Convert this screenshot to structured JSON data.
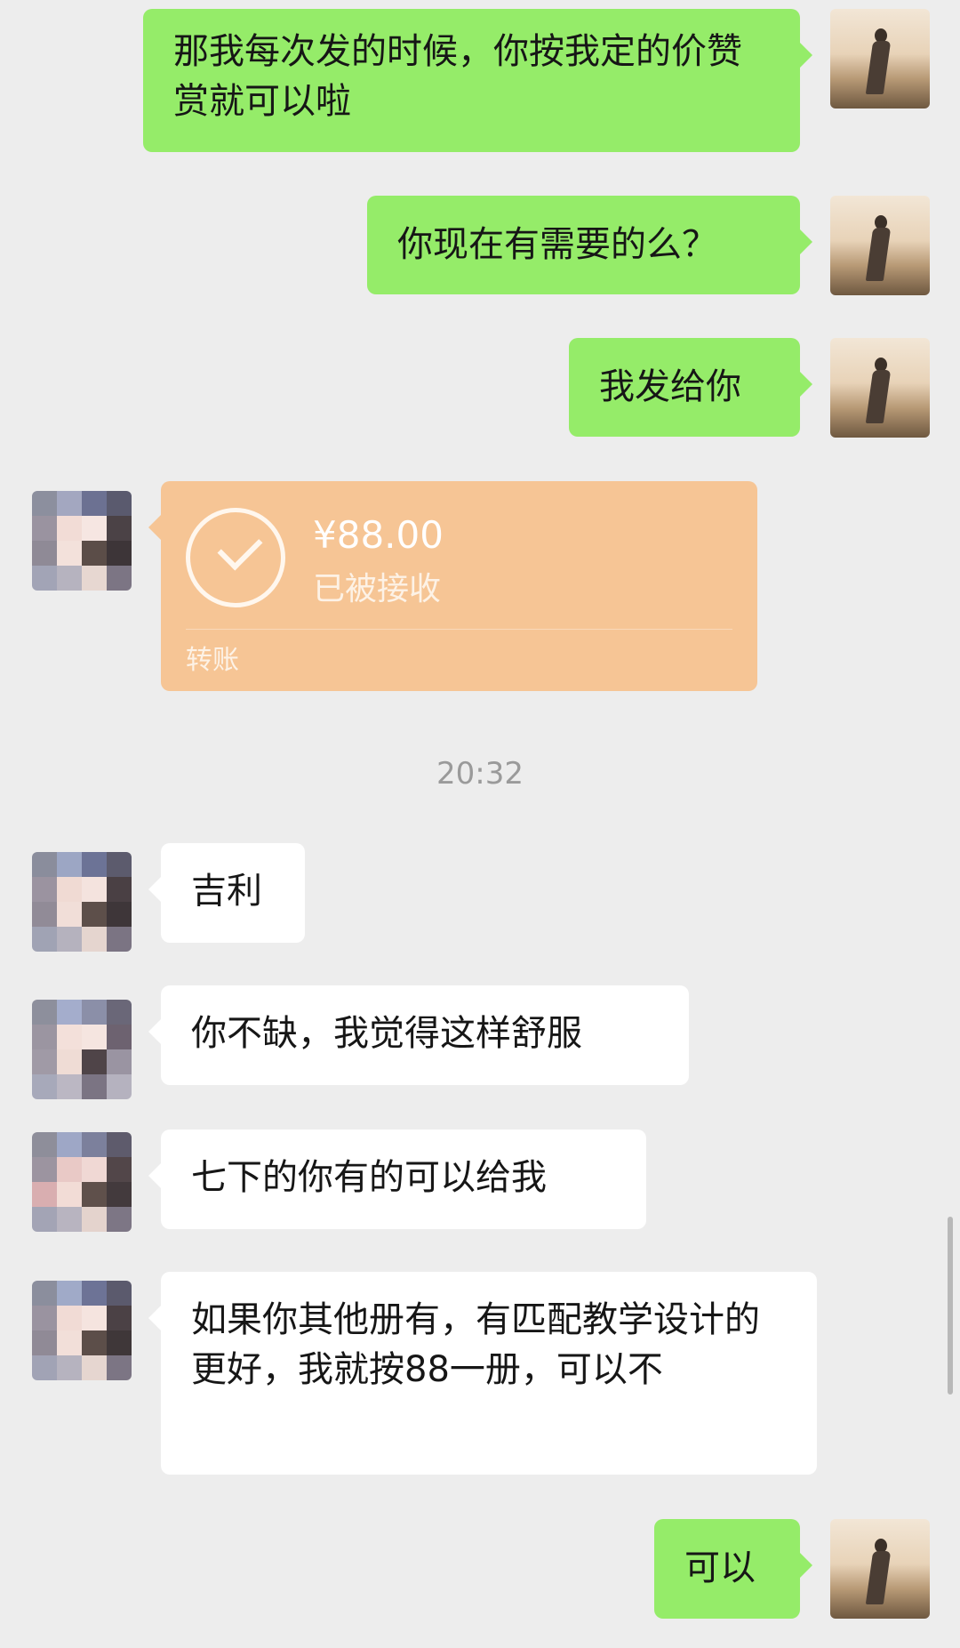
{
  "messages": {
    "m1": "那我每次发的时候，你按我定的价赞赏就可以啦",
    "m2": "你现在有需要的么？",
    "m3": "我发给你",
    "m5": "吉利",
    "m6": "你不缺，我觉得这样舒服",
    "m7": "七下的你有的可以给我",
    "m8": "如果你其他册有，有匹配教学设计的更好，我就按88一册，可以不",
    "m9": "可以"
  },
  "transfer": {
    "amount": "¥88.00",
    "status": "已被接收",
    "label": "转账"
  },
  "timestamp": "20:32",
  "colors": {
    "background": "#ededed",
    "sent_bubble": "#95ec69",
    "received_bubble": "#ffffff",
    "transfer_card": "#f6c595"
  },
  "icons": {
    "transfer_status": "check-circle-icon",
    "my_avatar": "photo-avatar",
    "contact_avatar": "pixelated-avatar"
  }
}
